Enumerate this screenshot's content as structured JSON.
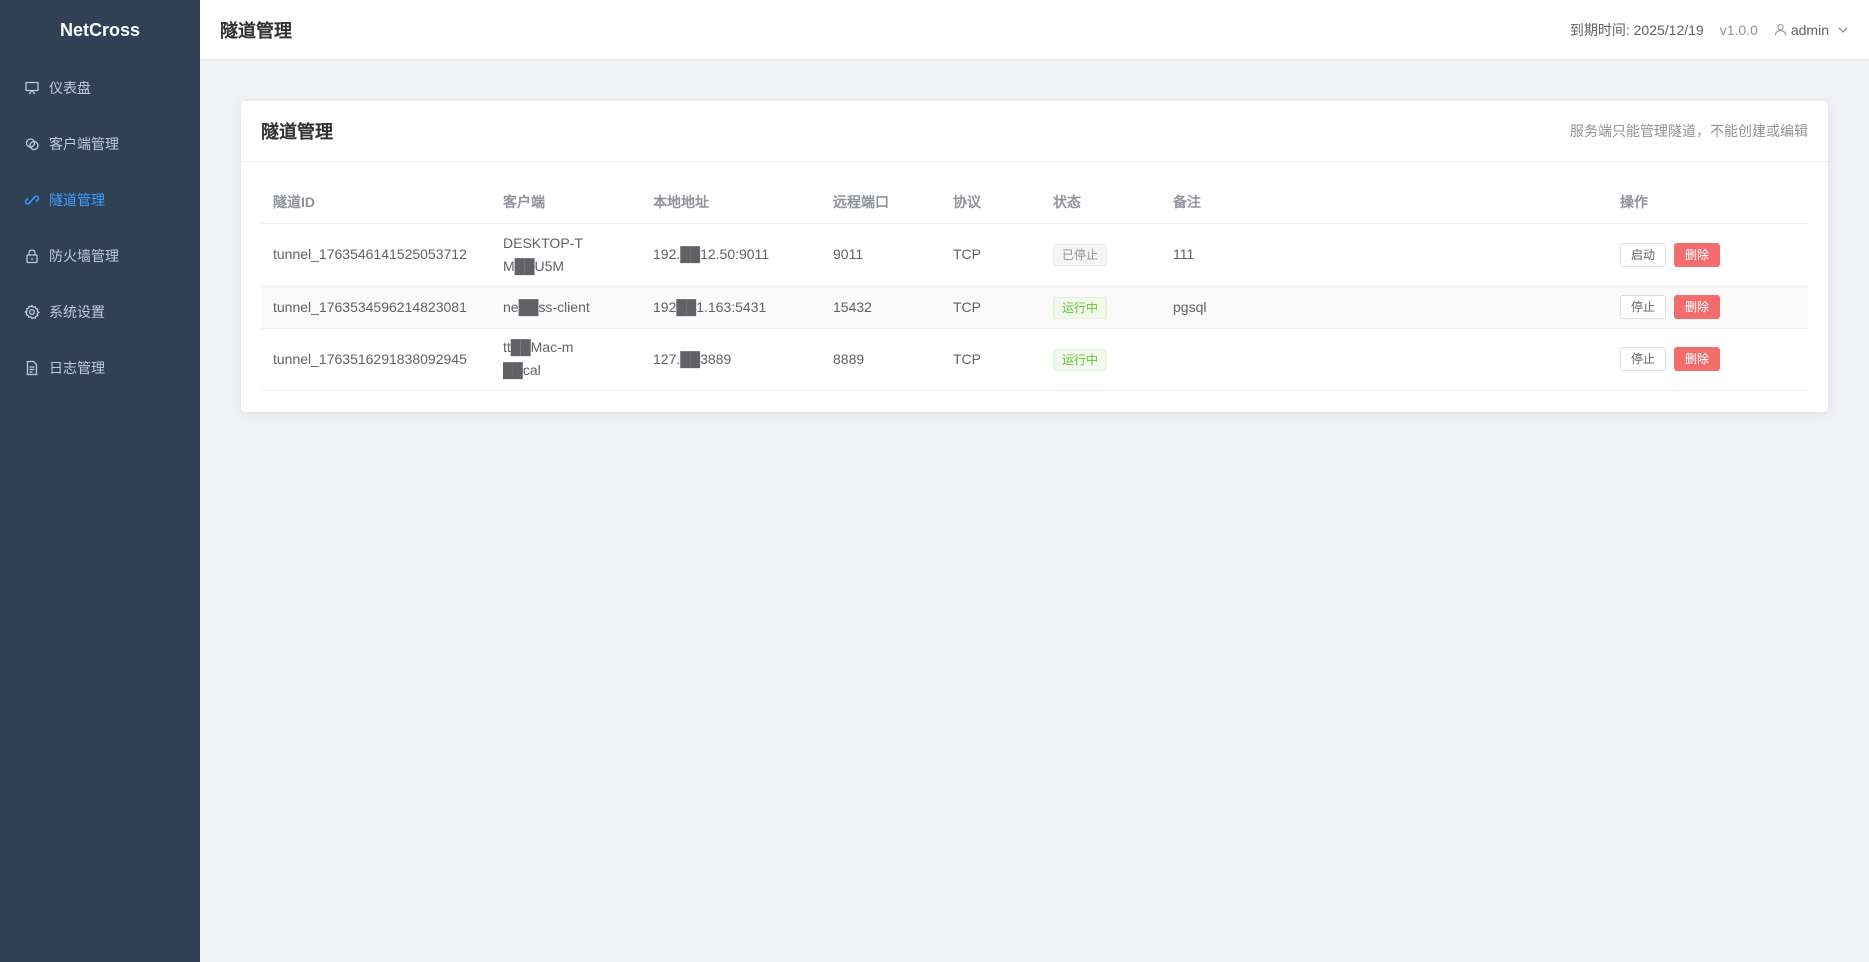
{
  "app": {
    "name": "NetCross"
  },
  "colors": {
    "sidebar": "#304156",
    "active": "#409eff",
    "danger": "#f56c6c",
    "running": "#67c23a"
  },
  "sidebar": {
    "items": [
      {
        "label": "仪表盘",
        "icon": "monitor-icon"
      },
      {
        "label": "客户端管理",
        "icon": "clients-icon"
      },
      {
        "label": "隧道管理",
        "icon": "link-icon",
        "active": true
      },
      {
        "label": "防火墙管理",
        "icon": "lock-icon"
      },
      {
        "label": "系统设置",
        "icon": "gear-icon"
      },
      {
        "label": "日志管理",
        "icon": "document-icon"
      }
    ]
  },
  "header": {
    "title": "隧道管理",
    "expiry": "到期时间: 2025/12/19",
    "version": "v1.0.0",
    "user": "admin"
  },
  "card": {
    "title": "隧道管理",
    "hint": "服务端只能管理隧道，不能创建或编辑"
  },
  "table": {
    "columns": [
      "隧道ID",
      "客户端",
      "本地地址",
      "远程端口",
      "协议",
      "状态",
      "备注",
      "操作"
    ],
    "rows": [
      {
        "id": "tunnel_1763546141525053712",
        "client": "DESKTOP-TM██U5M",
        "local": "192.██12.50:9011",
        "remote_port": "9011",
        "protocol": "TCP",
        "status": "已停止",
        "note": "111",
        "toggle_label": "启动",
        "delete_label": "删除"
      },
      {
        "id": "tunnel_1763534596214823081",
        "client": "ne██ss-client",
        "local": "192██1.163:5431",
        "remote_port": "15432",
        "protocol": "TCP",
        "status": "运行中",
        "note": "pgsql",
        "toggle_label": "停止",
        "delete_label": "删除"
      },
      {
        "id": "tunnel_1763516291838092945",
        "client": "tt██Mac-m██cal",
        "local": "127.██3889",
        "remote_port": "8889",
        "protocol": "TCP",
        "status": "运行中",
        "note": "",
        "toggle_label": "停止",
        "delete_label": "删除"
      }
    ]
  }
}
